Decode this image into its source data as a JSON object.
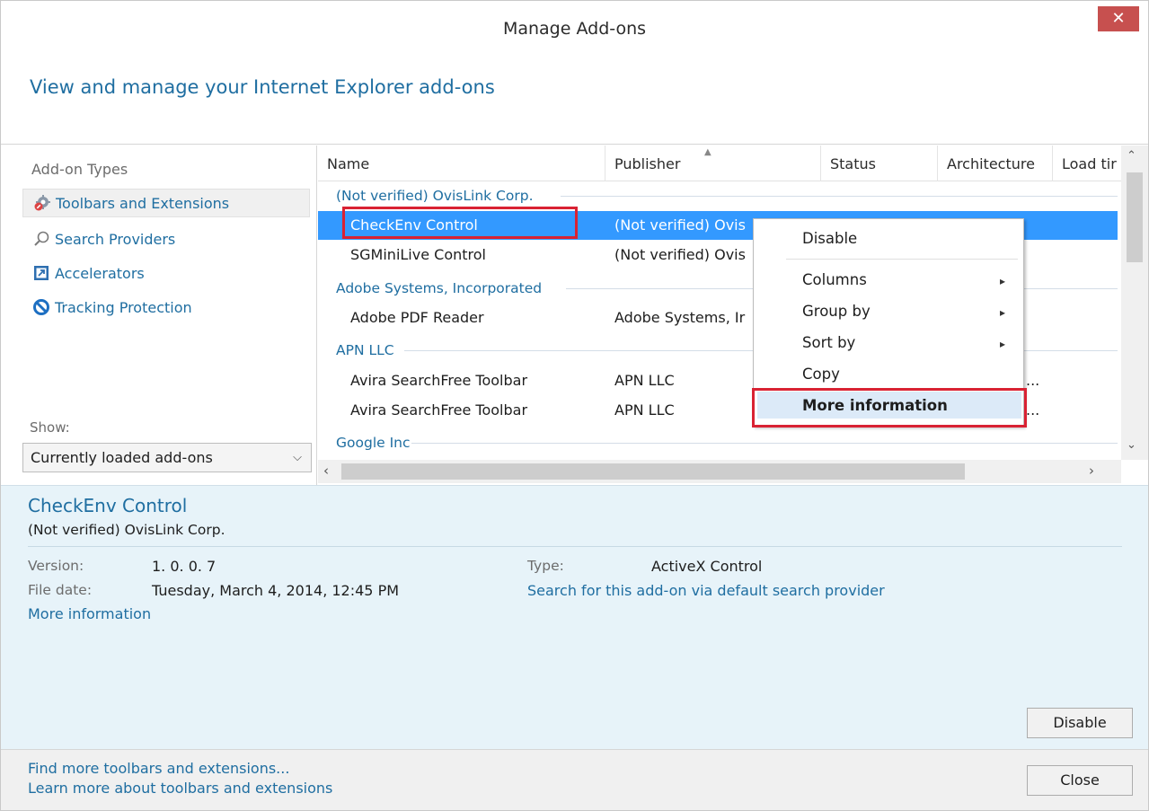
{
  "window": {
    "title": "Manage Add-ons",
    "close_glyph": "✕"
  },
  "header": {
    "text": "View and manage your Internet Explorer add-ons"
  },
  "sidebar": {
    "title": "Add-on Types",
    "items": [
      {
        "label": "Toolbars and Extensions",
        "icon": "gear-icon"
      },
      {
        "label": "Search Providers",
        "icon": "search-icon"
      },
      {
        "label": "Accelerators",
        "icon": "accelerator-icon"
      },
      {
        "label": "Tracking Protection",
        "icon": "block-icon"
      }
    ],
    "show_label": "Show:",
    "show_value": "Currently loaded add-ons"
  },
  "list": {
    "columns": [
      "Name",
      "Publisher",
      "Status",
      "Architecture",
      "Load tir"
    ],
    "groups": [
      {
        "name": "(Not verified) OvisLink Corp."
      },
      {
        "name": "Adobe Systems, Incorporated"
      },
      {
        "name": "APN LLC"
      },
      {
        "name": "Google Inc"
      }
    ],
    "rows": [
      {
        "name": "CheckEnv Control",
        "publisher": "(Not verified) Ovis"
      },
      {
        "name": "SGMiniLive Control",
        "publisher": "(Not verified) Ovis"
      },
      {
        "name": "Adobe PDF Reader",
        "publisher": "Adobe Systems, Ir"
      },
      {
        "name": "Avira SearchFree Toolbar",
        "publisher": "APN LLC",
        "trail": "..."
      },
      {
        "name": "Avira SearchFree Toolbar",
        "publisher": "APN LLC",
        "trail": "..."
      }
    ]
  },
  "context_menu": {
    "items": [
      "Disable",
      "Columns",
      "Group by",
      "Sort by",
      "Copy",
      "More information"
    ],
    "submenu_glyph": "▸"
  },
  "details": {
    "name": "CheckEnv Control",
    "publisher": "(Not verified) OvisLink Corp.",
    "version_label": "Version:",
    "version": "1. 0. 0. 7",
    "file_date_label": "File date:",
    "file_date": "Tuesday, March 4, 2014, 12:45 PM",
    "more_info": "More information",
    "type_label": "Type:",
    "type": "ActiveX Control",
    "search_link": "Search for this add-on via default search provider",
    "disable_button": "Disable"
  },
  "footer": {
    "link1": "Find more toolbars and extensions...",
    "link2": "Learn more about toolbars and extensions",
    "close_button": "Close"
  },
  "colors": {
    "accent": "#1f6ea1",
    "selection": "#3399ff",
    "highlight_box": "#d92233",
    "close_button_bg": "#c7504f",
    "details_bg": "#e7f3f9"
  }
}
